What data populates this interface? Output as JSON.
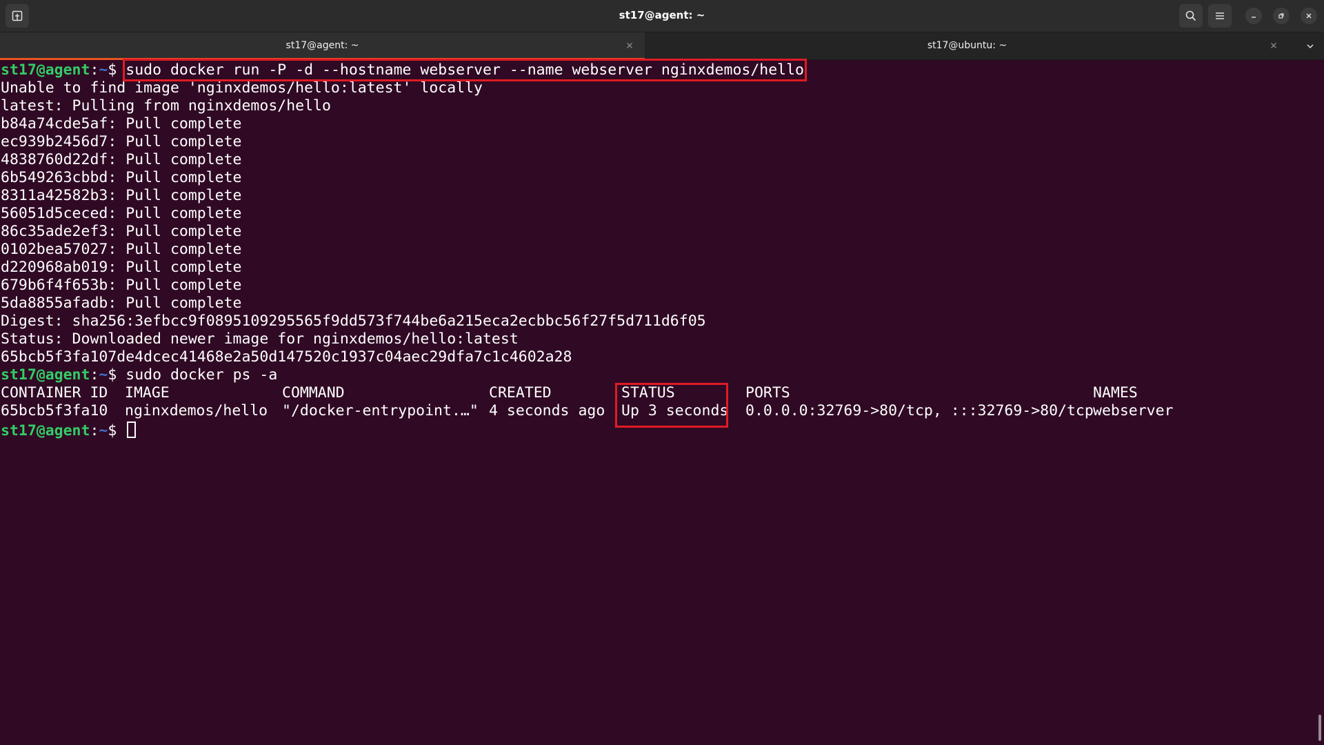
{
  "window": {
    "title": "st17@agent: ~"
  },
  "tabs": [
    {
      "label": "st17@agent: ~",
      "active": true
    },
    {
      "label": "st17@ubuntu: ~",
      "active": false
    }
  ],
  "icons": {
    "new_tab": "new-tab-icon",
    "search": "search-icon",
    "menu": "hamburger-menu-icon",
    "minimize": "minimize-icon",
    "restore": "restore-icon",
    "close": "close-icon",
    "tab_close": "close-icon",
    "tab_dropdown": "chevron-down-icon"
  },
  "colors": {
    "terminal_bg": "#300a24",
    "prompt_user": "#33cc66",
    "prompt_path": "#3f73c9",
    "highlight": "#e01b24",
    "tab_accent": "#e95420"
  },
  "prompt": {
    "user_host": "st17@agent",
    "colon": ":",
    "path": "~",
    "symbol": "$ "
  },
  "commands": {
    "run": "sudo docker run -P -d --hostname webserver --name webserver nginxdemos/hello",
    "ps": "sudo docker ps -a"
  },
  "output_lines": [
    "Unable to find image 'nginxdemos/hello:latest' locally",
    "latest: Pulling from nginxdemos/hello",
    "b84a74cde5af: Pull complete",
    "ec939b2456d7: Pull complete",
    "4838760d22df: Pull complete",
    "6b549263cbbd: Pull complete",
    "8311a42582b3: Pull complete",
    "56051d5ceced: Pull complete",
    "86c35ade2ef3: Pull complete",
    "0102bea57027: Pull complete",
    "d220968ab019: Pull complete",
    "679b6f4f653b: Pull complete",
    "5da8855afadb: Pull complete",
    "Digest: sha256:3efbcc9f0895109295565f9dd573f744be6a215eca2ecbbc56f27f5d711d6f05",
    "Status: Downloaded newer image for nginxdemos/hello:latest",
    "65bcb5f3fa107de4dcec41468e2a50d147520c1937c04aec29dfa7c1c4602a28"
  ],
  "ps_table": {
    "headers": {
      "container_id": "CONTAINER ID",
      "image": "IMAGE",
      "command": "COMMAND",
      "created": "CREATED",
      "status": "STATUS",
      "ports": "PORTS",
      "names": "NAMES"
    },
    "row": {
      "container_id": "65bcb5f3fa10",
      "image": "nginxdemos/hello",
      "command": "\"/docker-entrypoint.…\"",
      "created": "4 seconds ago",
      "status": "Up 3 seconds",
      "ports": "0.0.0.0:32769->80/tcp, :::32769->80/tcp",
      "names": "webserver"
    }
  }
}
